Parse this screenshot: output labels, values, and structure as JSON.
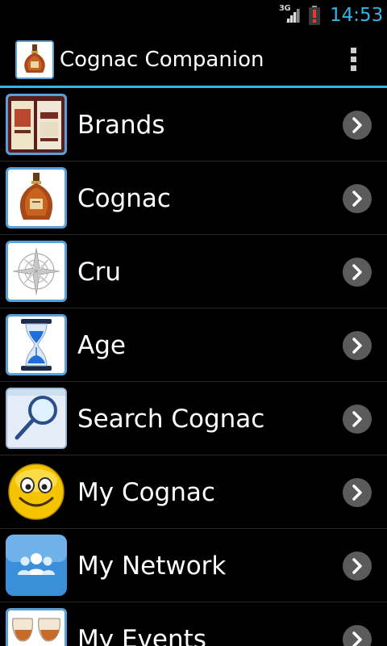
{
  "status_bar": {
    "network": "3G",
    "time": "14:53",
    "icons": [
      "signal-icon",
      "battery-alert-icon"
    ]
  },
  "action_bar": {
    "title": "Cognac Companion",
    "logo": "cognac-bottle-icon",
    "menu": "overflow-menu-icon"
  },
  "menu_items": [
    {
      "label": "Brands",
      "icon": "bottles-icon"
    },
    {
      "label": "Cognac",
      "icon": "cognac-bottle-icon"
    },
    {
      "label": "Cru",
      "icon": "compass-rose-icon"
    },
    {
      "label": "Age",
      "icon": "hourglass-icon"
    },
    {
      "label": "Search Cognac",
      "icon": "magnifier-icon"
    },
    {
      "label": "My Cognac",
      "icon": "smiley-icon"
    },
    {
      "label": "My Network",
      "icon": "people-icon"
    },
    {
      "label": "My Events",
      "icon": "glasses-icon"
    }
  ],
  "colors": {
    "accent": "#33b5e5",
    "background": "#000000",
    "icon_frame": "#5aa0d8",
    "chevron_bg": "#5b5b5b"
  }
}
